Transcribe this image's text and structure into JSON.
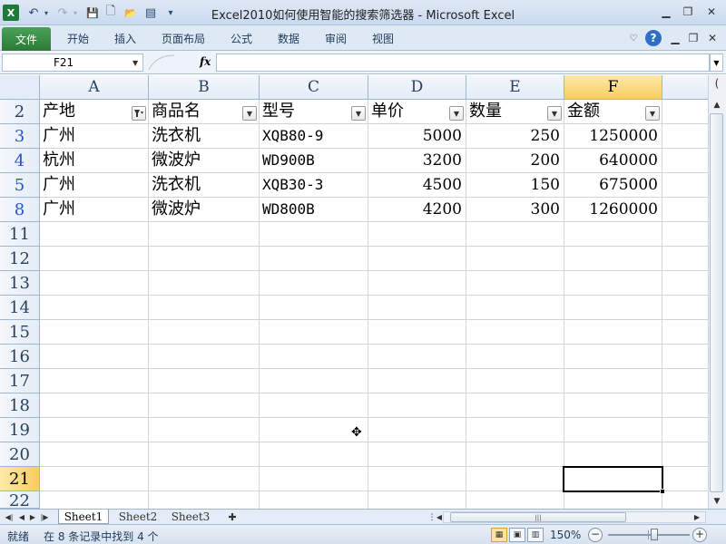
{
  "window": {
    "title": "Excel2010如何使用智能的搜索筛选器 - Microsoft Excel"
  },
  "qat": {
    "app_icon": "X",
    "undo_icon": "↶",
    "redo_icon": "↷",
    "save_icon": "💾",
    "new_icon": "🗋",
    "open_icon": "📂",
    "print_icon": "▤",
    "customize_icon": "▾"
  },
  "ribbon": {
    "file_tab": "文件",
    "tabs": [
      "开始",
      "插入",
      "页面布局",
      "公式",
      "数据",
      "审阅",
      "视图"
    ]
  },
  "formula_bar": {
    "name_box": "F21",
    "fx": "fx",
    "formula": ""
  },
  "columns": [
    "A",
    "B",
    "C",
    "D",
    "E",
    "F"
  ],
  "rows": [
    "2",
    "3",
    "4",
    "5",
    "8",
    "11",
    "12",
    "13",
    "14",
    "15",
    "16",
    "17",
    "18",
    "19",
    "20",
    "21",
    "22"
  ],
  "headers": [
    "产地",
    "商品名",
    "型号",
    "单价",
    "数量",
    "金额"
  ],
  "data_rows": [
    [
      "广州",
      "洗衣机",
      "XQB80-9",
      "5000",
      "250",
      "1250000"
    ],
    [
      "杭州",
      "微波炉",
      "WD900B",
      "3200",
      "200",
      "640000"
    ],
    [
      "广州",
      "洗衣机",
      "XQB30-3",
      "4500",
      "150",
      "675000"
    ],
    [
      "广州",
      "微波炉",
      "WD800B",
      "4200",
      "300",
      "1260000"
    ]
  ],
  "active_cell": "F21",
  "sheets": [
    "Sheet1",
    "Sheet2",
    "Sheet3"
  ],
  "status": {
    "ready": "就绪",
    "message": "在 8 条记录中找到 4 个",
    "zoom": "150%"
  }
}
